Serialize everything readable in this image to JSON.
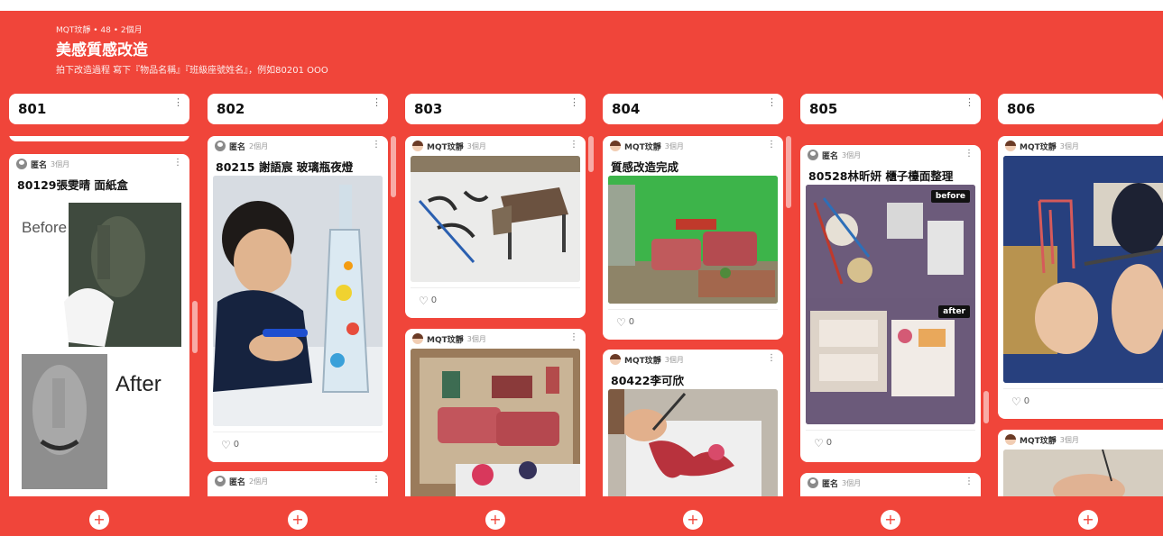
{
  "header": {
    "meta": "MQT玟靜 • 48 • 2個月",
    "title": "美感質感改造",
    "description": "拍下改造過程 寫下『物品名稱』『班級座號姓名』，例如80201 OOO"
  },
  "icons": {
    "more": "vertical-dots-icon",
    "like": "heart-icon",
    "add": "plus-icon"
  },
  "columns": [
    {
      "title": "801",
      "posts": [
        {
          "author": "匿名",
          "time": "3個月",
          "title": "80129張雯晴 面紙盒",
          "before_label": "Before",
          "after_label": "After"
        }
      ]
    },
    {
      "title": "802",
      "posts": [
        {
          "author": "匿名",
          "time": "2個月",
          "title": "80215 謝語宸 玻璃瓶夜燈",
          "likes": "0"
        },
        {
          "author": "匿名",
          "time": "2個月"
        }
      ]
    },
    {
      "title": "803",
      "posts": [
        {
          "author": "MQT玟靜",
          "time": "3個月",
          "likes": "0"
        },
        {
          "author": "MQT玟靜",
          "time": "3個月"
        }
      ]
    },
    {
      "title": "804",
      "posts": [
        {
          "author": "MQT玟靜",
          "time": "3個月",
          "title": "質感改造完成",
          "likes": "0"
        },
        {
          "author": "MQT玟靜",
          "time": "3個月",
          "title": "80422李可欣"
        }
      ]
    },
    {
      "title": "805",
      "posts": [
        {
          "author": "匿名",
          "time": "3個月",
          "title": "80528林昕妍 櫃子檯面整理",
          "before_label": "before",
          "after_label": "after",
          "likes": "0"
        },
        {
          "author": "匿名",
          "time": "3個月"
        }
      ]
    },
    {
      "title": "806",
      "posts": [
        {
          "author": "MQT玟靜",
          "time": "3個月",
          "likes": "0"
        },
        {
          "author": "MQT玟靜",
          "time": "3個月"
        }
      ]
    }
  ]
}
